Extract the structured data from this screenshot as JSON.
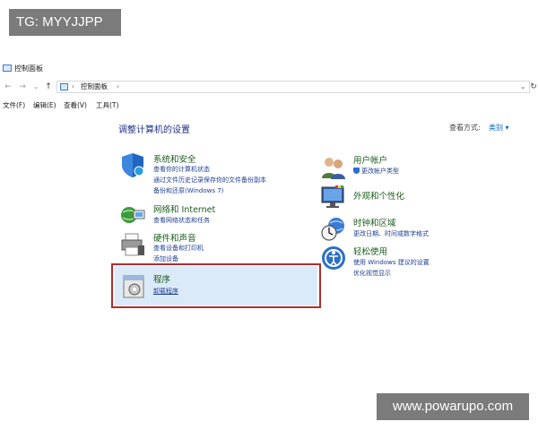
{
  "watermarks": {
    "top_left": "TG: MYYJJPP",
    "bottom_right": "www.powarupo.com"
  },
  "window": {
    "title": "控制面板",
    "title_icon": "control-panel-icon"
  },
  "nav": {
    "back": "←",
    "forward": "→",
    "dropdown": "⌄",
    "up": "↑",
    "path": "控制面板",
    "sep1": "›",
    "sep2": "›",
    "addr_dropdown": "⌄",
    "refresh": "↻"
  },
  "menu": [
    "文件(F)",
    "编辑(E)",
    "查看(V)",
    "工具(T)"
  ],
  "header": {
    "title": "调整计算机的设置",
    "view_by_label": "查看方式:",
    "view_by_value": "类别",
    "view_by_arrow": "▾"
  },
  "left_categories": [
    {
      "title": "系统和安全",
      "icon": "shield-icon",
      "links": [
        "查看你的计算机状态",
        "通过文件历史记录保存你的文件备份副本",
        "备份和还原(Windows 7)"
      ]
    },
    {
      "title": "网络和 Internet",
      "icon": "network-globe-icon",
      "links": [
        "查看网络状态和任务"
      ]
    },
    {
      "title": "硬件和声音",
      "icon": "printer-icon",
      "links": [
        "查看设备和打印机",
        "添加设备"
      ]
    },
    {
      "title": "程序",
      "icon": "programs-icon",
      "links": [
        "卸载程序"
      ]
    }
  ],
  "right_categories": [
    {
      "title": "用户帐户",
      "icon": "user-accounts-icon",
      "links": [
        "更改帐户类型"
      ]
    },
    {
      "title": "外观和个性化",
      "icon": "appearance-icon",
      "links": []
    },
    {
      "title": "时钟和区域",
      "icon": "clock-globe-icon",
      "links": [
        "更改日期、时间或数字格式"
      ]
    },
    {
      "title": "轻松使用",
      "icon": "ease-of-access-icon",
      "links": [
        "使用 Windows 建议的设置",
        "优化视觉显示"
      ]
    }
  ]
}
